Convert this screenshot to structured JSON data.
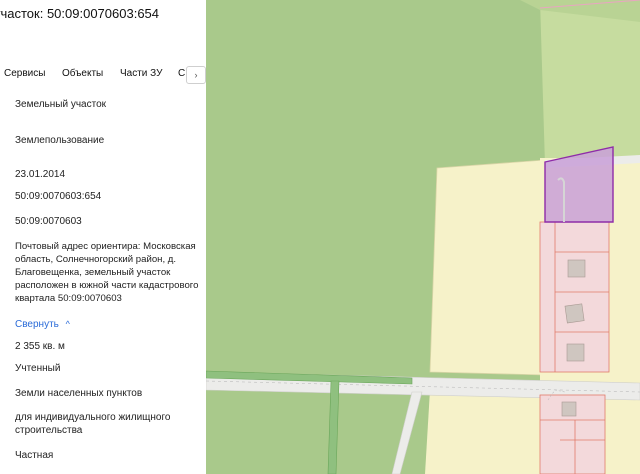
{
  "panel": {
    "title": "участок: 50:09:0070603:654",
    "tabs": [
      "Сервисы",
      "Объекты",
      "Части ЗУ",
      "С"
    ],
    "tab_next": "›",
    "rows": {
      "type": "Земельный участок",
      "kind": "Землепользование",
      "date": "23.01.2014",
      "cad_number": "50:09:0070603:654",
      "quarter": "50:09:0070603",
      "address": "Почтовый адрес ориентира: Московская область, Солнечногорский район, д. Благовещенка, земельный участок расположен в южной части кадастрового квартала 50:09:0070603",
      "collapse": "Свернуть",
      "collapse_icon": "^",
      "area": "2 355 кв. м",
      "status": "Учтенный",
      "category": "Земли населенных пунктов",
      "usage": "для индивидуального жилищного строительства",
      "ownership": "Частная"
    }
  },
  "map": {
    "colors": {
      "green": "#a8c88a",
      "yellow": "#f5f2c9",
      "road": "#ececea",
      "pink": "#f3d9db",
      "selected": "#c9a0d8",
      "selected_border": "#8e2ca8"
    }
  }
}
